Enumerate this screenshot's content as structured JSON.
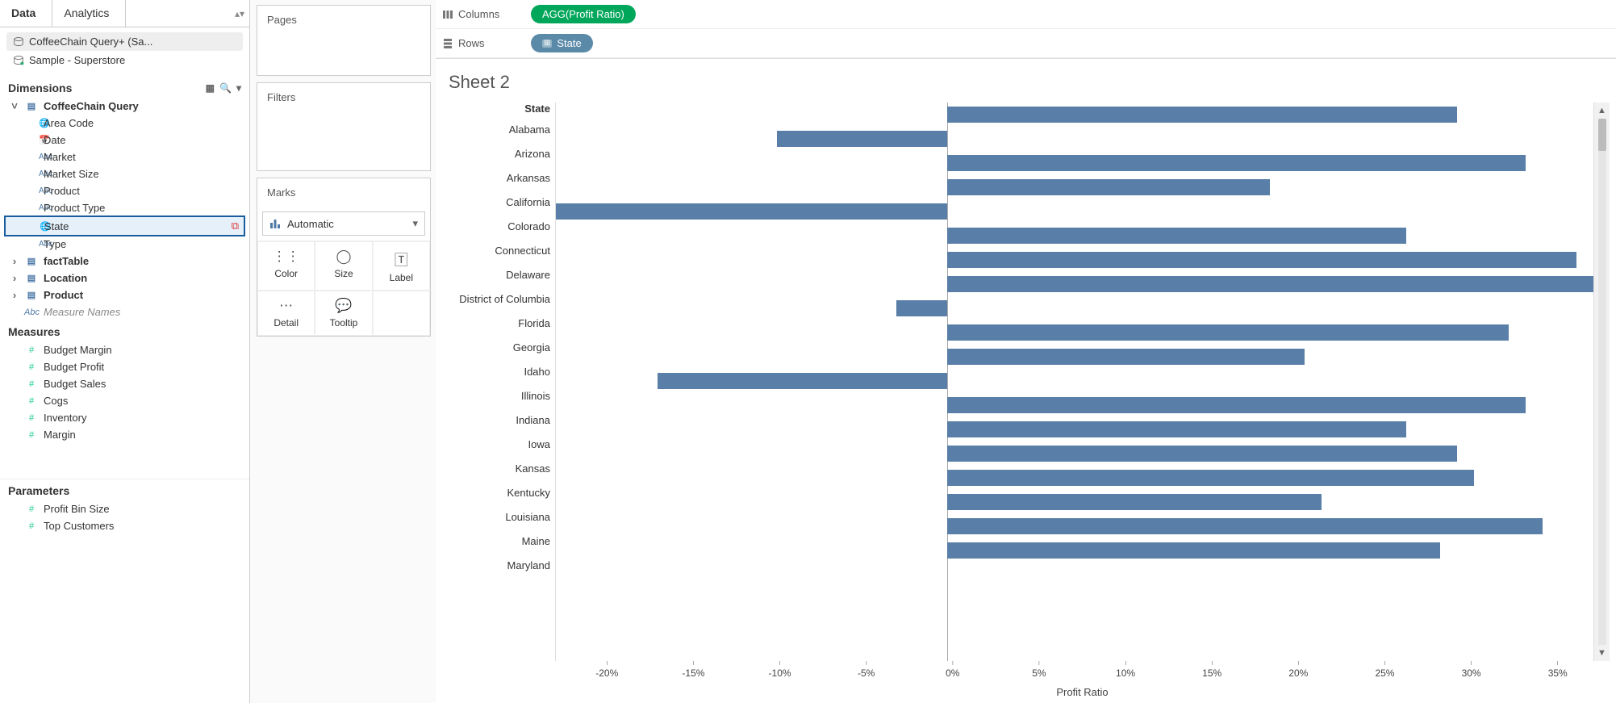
{
  "tabs": {
    "data": "Data",
    "analytics": "Analytics"
  },
  "data_sources": [
    {
      "label": "CoffeeChain Query+ (Sa...",
      "active": true
    },
    {
      "label": "Sample - Superstore",
      "active": false
    }
  ],
  "dimensions_header": "Dimensions",
  "dim_tree": {
    "group_label": "CoffeeChain Query",
    "items": [
      {
        "icon": "globe",
        "label": "Area Code"
      },
      {
        "icon": "date",
        "label": "Date"
      },
      {
        "icon": "abc",
        "label": "Market"
      },
      {
        "icon": "abc",
        "label": "Market Size"
      },
      {
        "icon": "abc",
        "label": "Product"
      },
      {
        "icon": "abc",
        "label": "Product Type"
      },
      {
        "icon": "globe",
        "label": "State",
        "selected": true,
        "linked": true
      },
      {
        "icon": "abc",
        "label": "Type"
      }
    ],
    "collapsed": [
      {
        "label": "factTable"
      },
      {
        "label": "Location"
      },
      {
        "label": "Product"
      }
    ],
    "measure_names": "Measure Names"
  },
  "measures_header": "Measures",
  "measures": [
    "Budget Margin",
    "Budget Profit",
    "Budget Sales",
    "Cogs",
    "Inventory",
    "Margin"
  ],
  "parameters_header": "Parameters",
  "parameters": [
    "Profit Bin Size",
    "Top Customers"
  ],
  "cards": {
    "pages": "Pages",
    "filters": "Filters",
    "marks": "Marks",
    "marks_type": "Automatic",
    "marks_cells": [
      {
        "key": "color",
        "label": "Color"
      },
      {
        "key": "size",
        "label": "Size"
      },
      {
        "key": "label",
        "label": "Label"
      },
      {
        "key": "detail",
        "label": "Detail"
      },
      {
        "key": "tooltip",
        "label": "Tooltip"
      }
    ]
  },
  "shelves": {
    "columns": {
      "label": "Columns",
      "pill": "AGG(Profit Ratio)"
    },
    "rows": {
      "label": "Rows",
      "pill": "State"
    }
  },
  "viz_title": "Sheet 2",
  "state_col_header": "State",
  "x_axis_title": "Profit Ratio",
  "chart_data": {
    "type": "bar",
    "categories": [
      "Alabama",
      "Arizona",
      "Arkansas",
      "California",
      "Colorado",
      "Connecticut",
      "Delaware",
      "District of Columbia",
      "Florida",
      "Georgia",
      "Idaho",
      "Illinois",
      "Indiana",
      "Iowa",
      "Kansas",
      "Kentucky",
      "Louisiana",
      "Maine",
      "Maryland"
    ],
    "values": [
      0.3,
      -0.1,
      0.34,
      0.19,
      -0.23,
      0.27,
      0.37,
      0.38,
      -0.03,
      0.33,
      0.21,
      -0.17,
      0.34,
      0.27,
      0.3,
      0.31,
      0.22,
      0.35,
      0.29
    ],
    "xlabel": "Profit Ratio",
    "ylabel": "State",
    "xlim": [
      -0.23,
      0.38
    ],
    "ticks": [
      -0.2,
      -0.15,
      -0.1,
      -0.05,
      0.0,
      0.05,
      0.1,
      0.15,
      0.2,
      0.25,
      0.3,
      0.35
    ],
    "tick_labels": [
      "-20%",
      "-15%",
      "-10%",
      "-5%",
      "0%",
      "5%",
      "10%",
      "15%",
      "20%",
      "25%",
      "30%",
      "35%"
    ]
  }
}
